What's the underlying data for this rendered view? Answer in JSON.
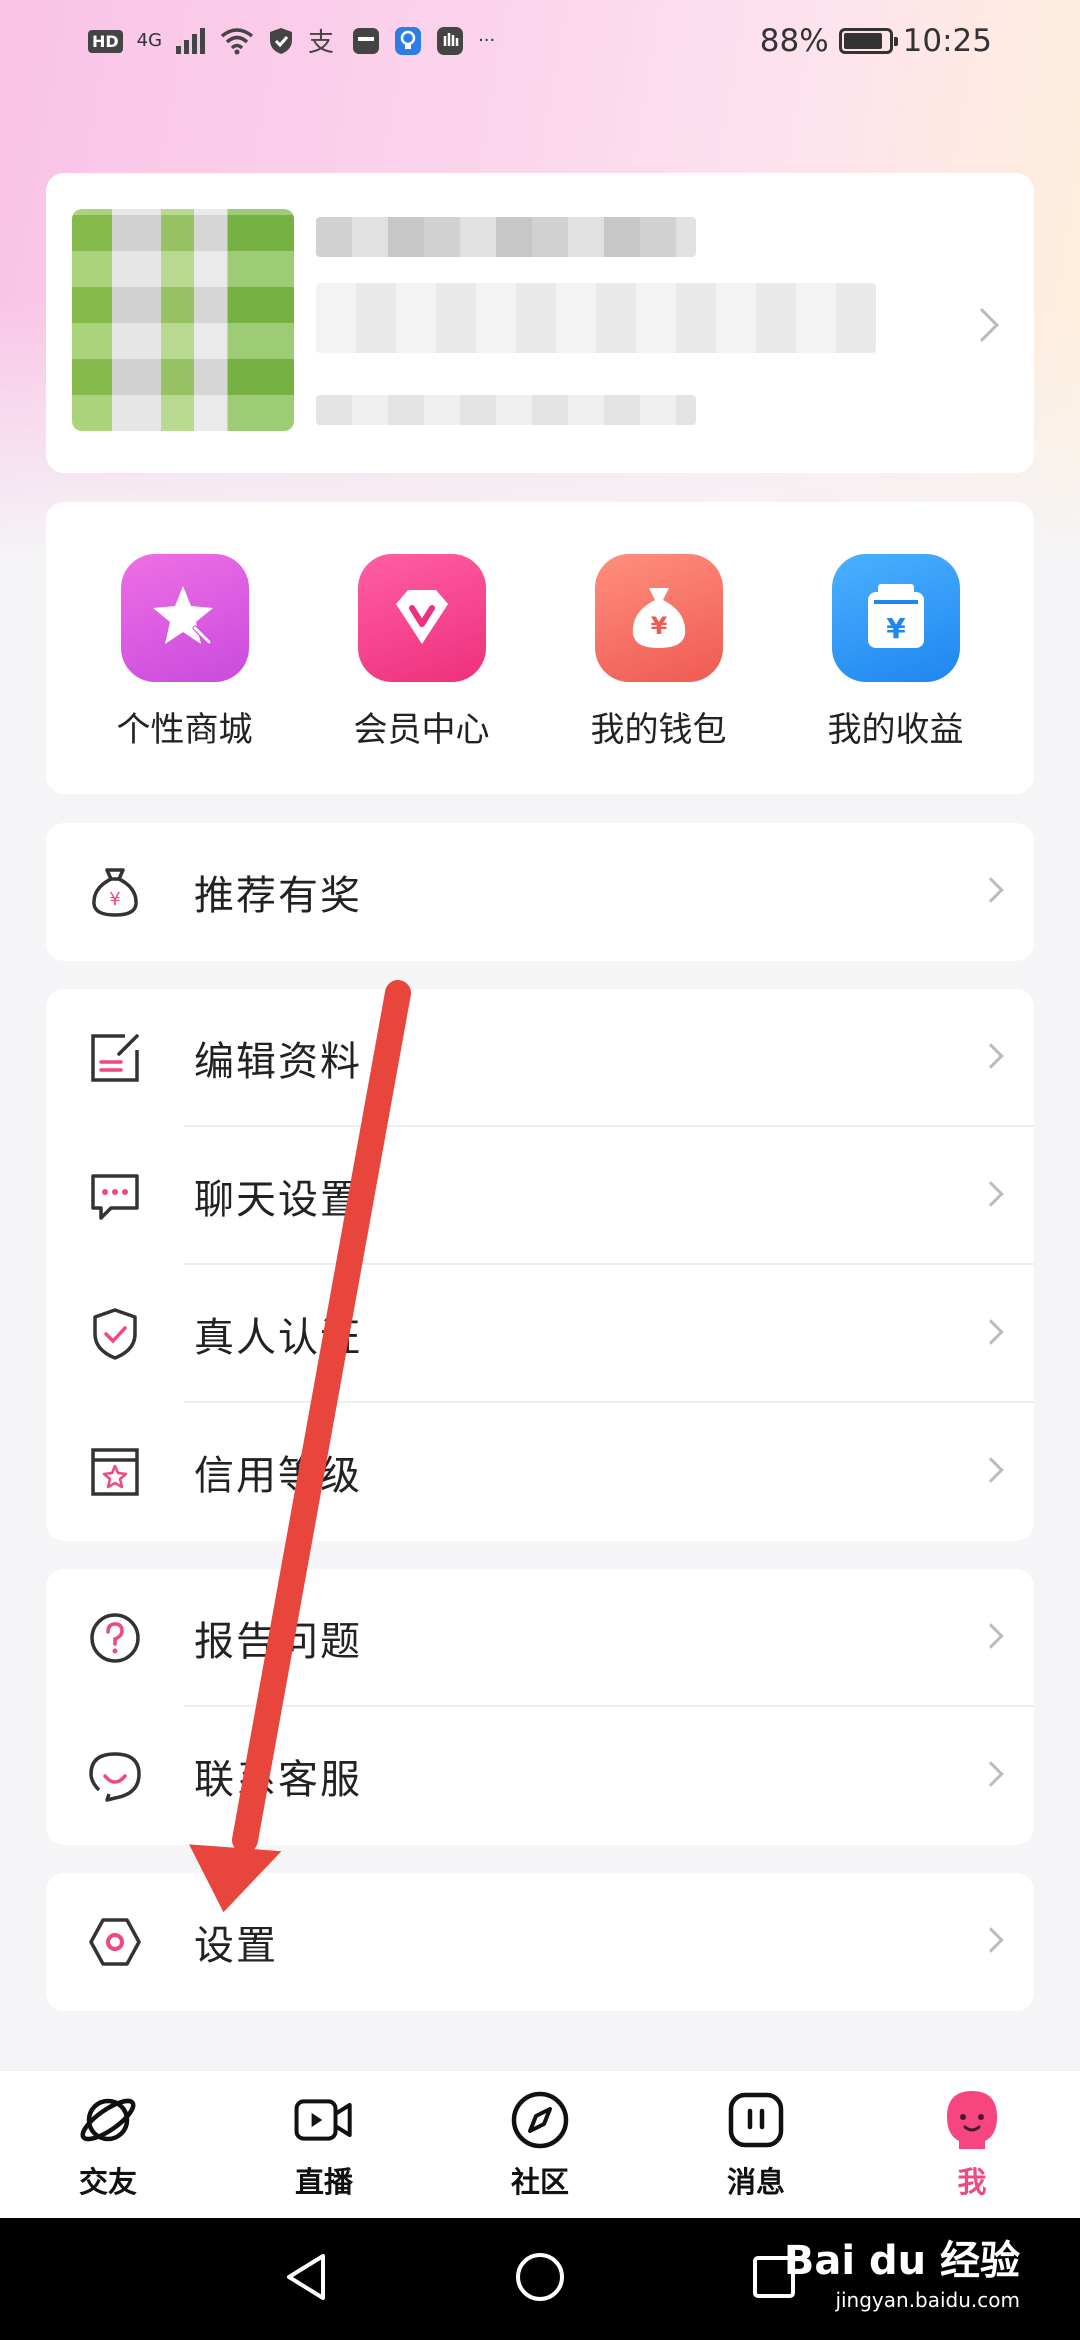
{
  "status_bar": {
    "badge": "HD",
    "network": "4G",
    "extra": "···",
    "battery": "88%",
    "battery_level": 0.88,
    "time": "10:25"
  },
  "profile": {
    "name": "",
    "id": ""
  },
  "quick_actions": [
    {
      "label": "个性商城",
      "icon": "star-wand-icon",
      "color_from": "#ef6fe6",
      "color_to": "#c84bdc"
    },
    {
      "label": "会员中心",
      "icon": "diamond-v-icon",
      "color_from": "#ff5fa4",
      "color_to": "#ee2f7c"
    },
    {
      "label": "我的钱包",
      "icon": "money-bag-icon",
      "color_from": "#ff8f7e",
      "color_to": "#ef5a52"
    },
    {
      "label": "我的收益",
      "icon": "yen-box-icon",
      "color_from": "#4bb1ff",
      "color_to": "#1e86f0"
    }
  ],
  "menu": {
    "referral": {
      "label": "推荐有奖"
    },
    "edit_profile": {
      "label": "编辑资料"
    },
    "chat_settings": {
      "label": "聊天设置"
    },
    "verification": {
      "label": "真人认证"
    },
    "credit_level": {
      "label": "信用等级"
    },
    "report_issue": {
      "label": "报告问题"
    },
    "contact_support": {
      "label": "联系客服"
    },
    "settings": {
      "label": "设置"
    }
  },
  "bottom_nav": [
    {
      "label": "交友",
      "icon": "planet-icon"
    },
    {
      "label": "直播",
      "icon": "video-camera-icon"
    },
    {
      "label": "社区",
      "icon": "compass-icon"
    },
    {
      "label": "消息",
      "icon": "message-icon"
    },
    {
      "label": "我",
      "icon": "profile-face-icon",
      "active": true
    }
  ],
  "watermark": {
    "brand": "Bai du 经验",
    "url": "jingyan.baidu.com"
  },
  "colors": {
    "accent": "#f0487f",
    "arrow": "#e8453c"
  }
}
